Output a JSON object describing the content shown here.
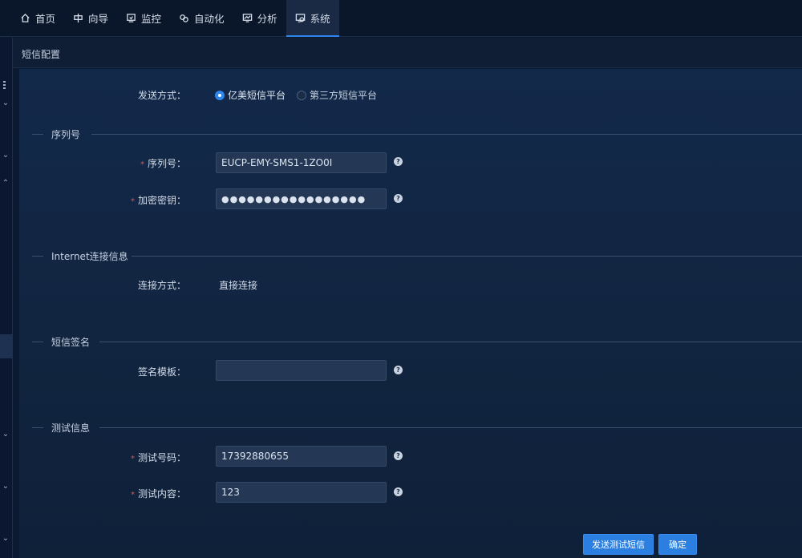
{
  "nav": {
    "items": [
      {
        "label": "首页",
        "icon": "home-icon"
      },
      {
        "label": "向导",
        "icon": "guide-icon"
      },
      {
        "label": "监控",
        "icon": "monitor-icon"
      },
      {
        "label": "自动化",
        "icon": "automation-icon"
      },
      {
        "label": "分析",
        "icon": "analysis-icon"
      },
      {
        "label": "系统",
        "icon": "system-icon",
        "active": true
      }
    ]
  },
  "page": {
    "title": "短信配置"
  },
  "send_method": {
    "label": "发送方式：",
    "options": [
      "亿美短信平台",
      "第三方短信平台"
    ],
    "selected": "亿美短信平台"
  },
  "sections": {
    "serial": "序列号",
    "internet": "Internet连接信息",
    "signature": "短信签名",
    "test": "测试信息"
  },
  "fields": {
    "serial_no": {
      "label": "序列号：",
      "value": "EUCP-EMY-SMS1-1ZO0I"
    },
    "encrypt_key": {
      "label": "加密密钥：",
      "value": "●●●●●●●●●●●●●●●●●"
    },
    "connect_method": {
      "label": "连接方式：",
      "value": "直接连接"
    },
    "sign_template": {
      "label": "签名模板：",
      "value": ""
    },
    "test_number": {
      "label": "测试号码：",
      "value": "17392880655"
    },
    "test_content": {
      "label": "测试内容：",
      "value": "123"
    }
  },
  "buttons": {
    "send_test": "发送测试短信",
    "confirm": "确定"
  },
  "help_glyph": "?",
  "required_mark": "*",
  "colors": {
    "accent": "#2f86ea",
    "required": "#e25252"
  }
}
